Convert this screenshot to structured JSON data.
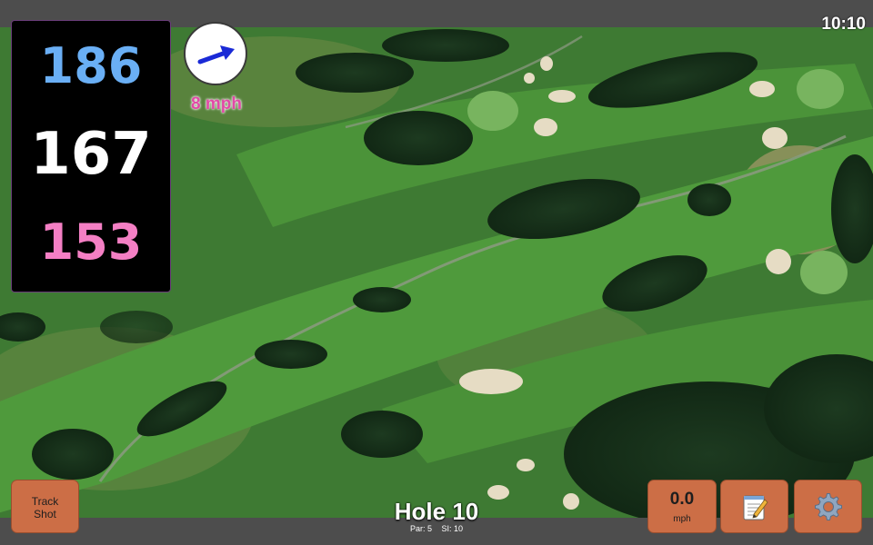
{
  "status_bar": {
    "time": "10:10"
  },
  "distances": {
    "back": "186",
    "middle": "167",
    "front": "153"
  },
  "wind": {
    "speed_label": "8 mph",
    "direction_icon": "arrow-icon"
  },
  "hole": {
    "title": "Hole 10",
    "par_label": "Par: 5",
    "si_label": "SI: 10"
  },
  "buttons": {
    "track_shot_line1": "Track",
    "track_shot_line2": "Shot",
    "speed_value": "0.0",
    "speed_unit": "mph",
    "notes_icon": "notepad-icon",
    "settings_icon": "gear-icon"
  },
  "colors": {
    "back_distance": "#6aaff5",
    "middle_distance": "#ffffff",
    "front_distance": "#f47fc4",
    "wind_speed": "#e14aa6",
    "button": "#cc6e46"
  }
}
